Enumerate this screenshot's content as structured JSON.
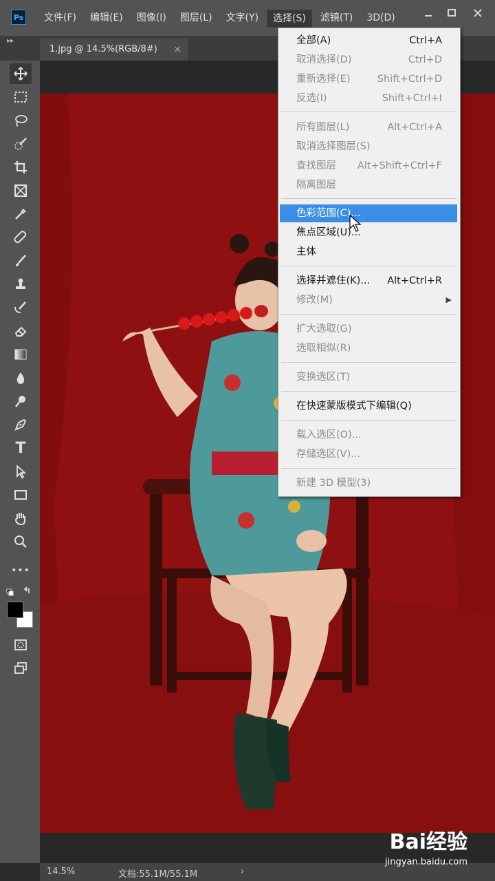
{
  "app": {
    "logo": "Ps"
  },
  "menubar": {
    "items": [
      "文件(F)",
      "编辑(E)",
      "图像(I)",
      "图层(L)",
      "文字(Y)",
      "选择(S)",
      "滤镜(T)",
      "3D(D)"
    ],
    "window_controls": [
      "minimize-icon",
      "maximize-icon",
      "close-icon"
    ]
  },
  "tab": {
    "title": "1.jpg @ 14.5%(RGB/8#)",
    "close": "×",
    "collapse": "▸▸"
  },
  "toolbar": {
    "tools": [
      "move-icon",
      "marquee-icon",
      "lasso-icon",
      "quick-select-icon",
      "crop-icon",
      "frame-icon",
      "eyedropper-icon",
      "healing-brush-icon",
      "brush-icon",
      "clone-stamp-icon",
      "history-brush-icon",
      "eraser-icon",
      "gradient-icon",
      "blur-icon",
      "dodge-icon",
      "pen-icon",
      "type-icon",
      "path-select-icon",
      "rectangle-icon",
      "hand-icon",
      "zoom-icon",
      "more-tools-icon",
      "swap-colors-icon",
      "color-swatch",
      "quick-mask-icon",
      "screen-mode-icon"
    ],
    "type_label": "T",
    "more_label": "•••"
  },
  "select_menu": {
    "items": [
      {
        "label": "全部(A)",
        "shortcut": "Ctrl+A",
        "state": "enabled"
      },
      {
        "label": "取消选择(D)",
        "shortcut": "Ctrl+D",
        "state": "disabled"
      },
      {
        "label": "重新选择(E)",
        "shortcut": "Shift+Ctrl+D",
        "state": "disabled"
      },
      {
        "label": "反选(I)",
        "shortcut": "Shift+Ctrl+I",
        "state": "disabled"
      },
      {
        "label": "所有图层(L)",
        "shortcut": "Alt+Ctrl+A",
        "state": "disabled"
      },
      {
        "label": "取消选择图层(S)",
        "shortcut": "",
        "state": "disabled"
      },
      {
        "label": "查找图层",
        "shortcut": "Alt+Shift+Ctrl+F",
        "state": "disabled"
      },
      {
        "label": "隔离图层",
        "shortcut": "",
        "state": "disabled"
      },
      {
        "label": "色彩范围(C)...",
        "shortcut": "",
        "state": "highlight"
      },
      {
        "label": "焦点区域(U)...",
        "shortcut": "",
        "state": "enabled"
      },
      {
        "label": "主体",
        "shortcut": "",
        "state": "enabled"
      },
      {
        "label": "选择并遮住(K)...",
        "shortcut": "Alt+Ctrl+R",
        "state": "enabled"
      },
      {
        "label": "修改(M)",
        "shortcut": "",
        "state": "disabled",
        "submenu": "▶"
      },
      {
        "label": "扩大选取(G)",
        "shortcut": "",
        "state": "disabled"
      },
      {
        "label": "选取相似(R)",
        "shortcut": "",
        "state": "disabled"
      },
      {
        "label": "变换选区(T)",
        "shortcut": "",
        "state": "disabled"
      },
      {
        "label": "在快速蒙版模式下编辑(Q)",
        "shortcut": "",
        "state": "enabled"
      },
      {
        "label": "载入选区(O)...",
        "shortcut": "",
        "state": "disabled"
      },
      {
        "label": "存储选区(V)...",
        "shortcut": "",
        "state": "disabled"
      },
      {
        "label": "新建 3D 模型(3)",
        "shortcut": "",
        "state": "disabled"
      }
    ]
  },
  "status": {
    "zoom": "14.5%",
    "doc": "文档:55.1M/55.1M",
    "arrow": "›"
  },
  "watermark": {
    "brand": "Bai经验",
    "url": "jingyan.baidu.com"
  },
  "colors": {
    "highlight": "#3a8ee6",
    "background": "#8a0f0f"
  }
}
